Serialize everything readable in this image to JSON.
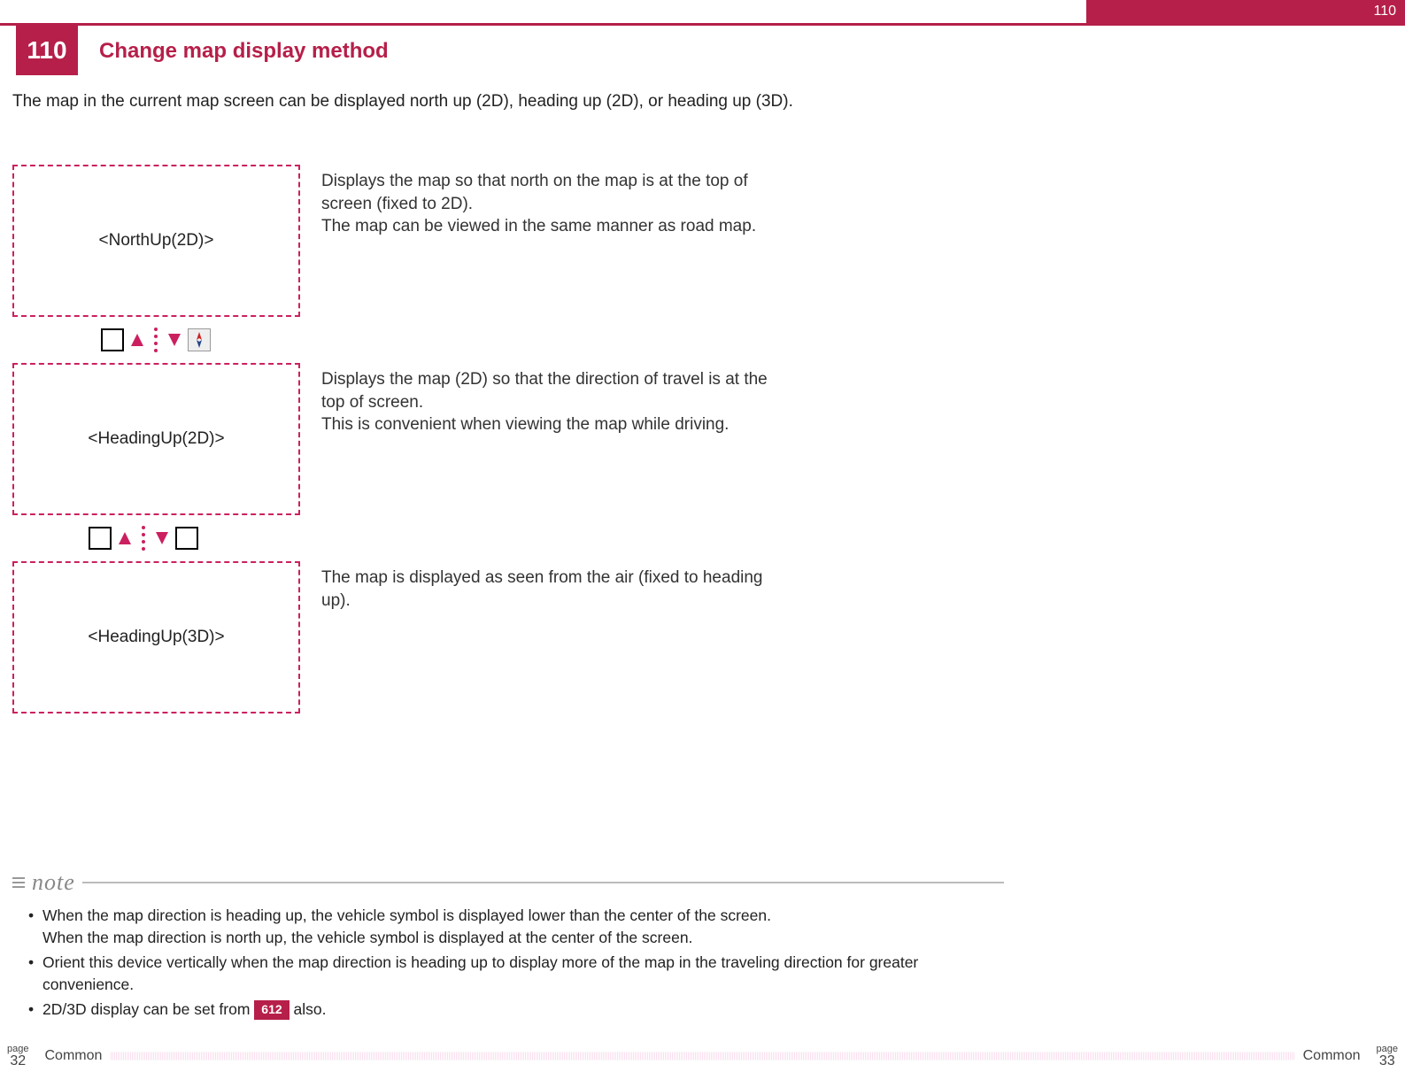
{
  "header": {
    "section_number_top": "110",
    "section_number_badge": "110",
    "title": "Change map display method"
  },
  "intro": "The map in the current map screen can be displayed north up (2D), heading up (2D), or heading up (3D).",
  "modes": [
    {
      "label": "<NorthUp(2D)>",
      "desc_l1": "Displays the map so that north on the map is at the top of screen (fixed to 2D).",
      "desc_l2": "The map can be viewed in the same manner as road map."
    },
    {
      "label": "<HeadingUp(2D)>",
      "desc_l1": "Displays the map (2D) so that the direction of travel is at the top of screen.",
      "desc_l2": "This is convenient when viewing the map while driving."
    },
    {
      "label": "<HeadingUp(3D)>",
      "desc_l1": "The map is displayed as seen from the air (fixed to heading up).",
      "desc_l2": ""
    }
  ],
  "note": {
    "heading": "note",
    "items": {
      "i1a": "When the map direction is heading up, the vehicle symbol is displayed lower than the center of the screen.",
      "i1b": "When the map direction is north up, the vehicle symbol is displayed at the center of the screen.",
      "i2": "Orient this device vertically when the map direction is heading up to display more of the map in the traveling direction for greater convenience.",
      "i3a": "2D/3D display can be set from ",
      "i3_ref": "612",
      "i3b": " also."
    }
  },
  "footer": {
    "left_page_label": "page",
    "left_page_num": "32",
    "left_section": "Common",
    "right_section": "Common",
    "right_page_label": "page",
    "right_page_num": "33"
  }
}
